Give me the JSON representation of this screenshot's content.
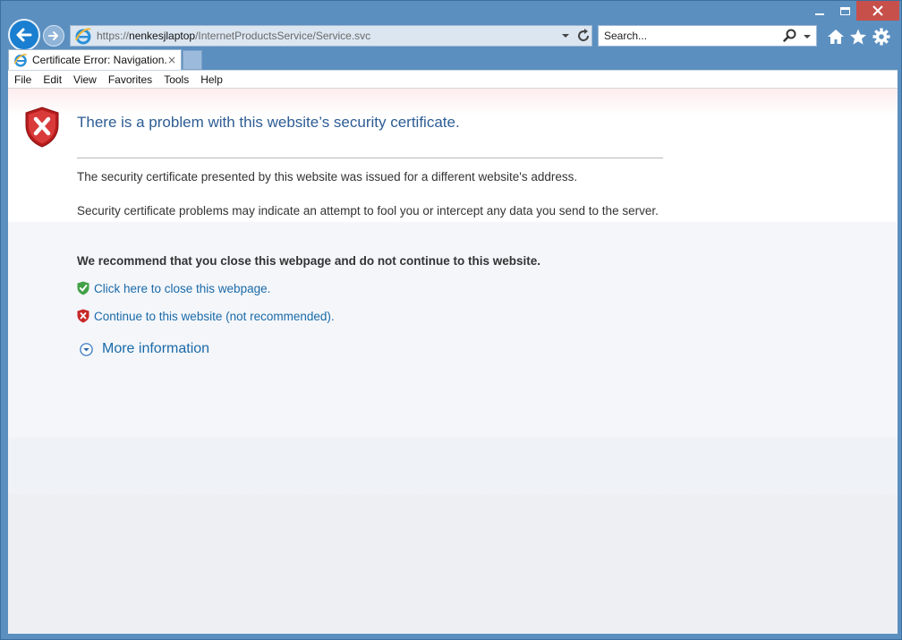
{
  "window": {
    "caption_buttons": [
      "minimize",
      "maximize",
      "close"
    ],
    "close_color": "#c7504b"
  },
  "nav": {
    "back_icon": "back-arrow-icon",
    "forward_icon": "forward-arrow-icon",
    "address": {
      "scheme": "https://",
      "host": "nenkesjlaptop",
      "path": "/InternetProductsService/Service.svc"
    },
    "search": {
      "placeholder": "Search..."
    },
    "tools": [
      "home-icon",
      "favorites-star-icon",
      "settings-gear-icon"
    ]
  },
  "tab": {
    "title": "Certificate Error: Navigation...",
    "close": "×"
  },
  "menu": {
    "items": [
      "File",
      "Edit",
      "View",
      "Favorites",
      "Tools",
      "Help"
    ]
  },
  "page": {
    "title": "There is a problem with this website’s security certificate.",
    "paragraph1": "The security certificate presented by this website was issued for a different website's address.",
    "paragraph2": "Security certificate problems may indicate an attempt to fool you or intercept any data you send to the server.",
    "recommendation": "We recommend that you close this webpage and do not continue to this website.",
    "close_link": "Click here to close this webpage.",
    "continue_link": "Continue to this website (not recommended).",
    "more_info": "More information",
    "colors": {
      "title": "#2d5c94",
      "link": "#1a6aa8",
      "shield_red": "#c62828",
      "shield_green": "#43a047",
      "chrome_blue": "#5b8fc0"
    }
  }
}
